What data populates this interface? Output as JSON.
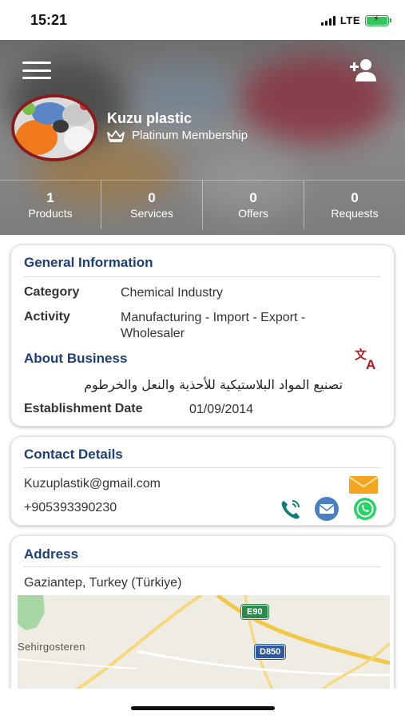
{
  "status_bar": {
    "time": "15:21",
    "network": "LTE"
  },
  "profile": {
    "company_name": "Kuzu plastic",
    "membership": "Platinum Membership"
  },
  "stats": [
    {
      "value": "1",
      "label": "Products"
    },
    {
      "value": "0",
      "label": "Services"
    },
    {
      "value": "0",
      "label": "Offers"
    },
    {
      "value": "0",
      "label": "Requests"
    }
  ],
  "general": {
    "title": "General Information",
    "category_label": "Category",
    "category_value": "Chemical Industry",
    "activity_label": "Activity",
    "activity_line1": "Manufacturing - Import - Export -",
    "activity_line2": "Wholesaler",
    "about_title": "About Business",
    "about_text": "تصنيع المواد البلاستيكية للأحذية والنعل والخرطوم",
    "establishment_label": "Establishment Date",
    "establishment_value": "01/09/2014"
  },
  "contact": {
    "title": "Contact Details",
    "email": "Kuzuplastik@gmail.com",
    "phone": "+905393390230"
  },
  "address": {
    "title": "Address",
    "location": "Gaziantep, Turkey (Türkiye)",
    "map_place": "Sehirgosteren",
    "road_1": "E90",
    "road_2": "D850"
  },
  "colors": {
    "title_blue": "#1c3f78",
    "avatar_border": "#8e1b1b",
    "translate_red": "#b5161b",
    "whatsapp_green": "#25d366",
    "phone_teal": "#0d7f74",
    "battery_green": "#34c759"
  },
  "icons": [
    "menu-icon",
    "add-user-icon",
    "crown-icon",
    "translate-icon",
    "mail-icon",
    "phone-icon",
    "message-icon",
    "whatsapp-icon"
  ]
}
